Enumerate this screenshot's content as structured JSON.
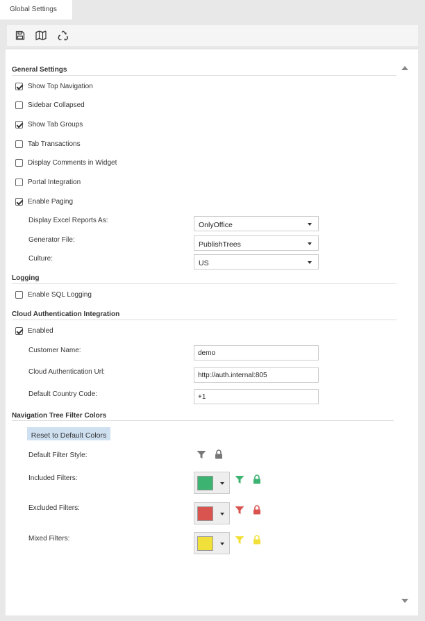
{
  "tab": {
    "title": "Global Settings"
  },
  "toolbar": {
    "save_icon": "save-icon",
    "map_icon": "map-icon",
    "recycle_icon": "recycle-icon"
  },
  "general": {
    "title": "General Settings",
    "checkboxes": [
      {
        "label": "Show Top Navigation",
        "checked": true
      },
      {
        "label": "Sidebar Collapsed",
        "checked": false
      },
      {
        "label": "Show Tab Groups",
        "checked": true
      },
      {
        "label": "Tab Transactions",
        "checked": false
      },
      {
        "label": "Display Comments in Widget",
        "checked": false
      },
      {
        "label": "Portal Integration",
        "checked": false
      },
      {
        "label": "Enable Paging",
        "checked": true
      }
    ],
    "excel_label": "Display Excel Reports As:",
    "excel_value": "OnlyOffice",
    "generator_label": "Generator File:",
    "generator_value": "PublishTrees",
    "culture_label": "Culture:",
    "culture_value": "US"
  },
  "logging": {
    "title": "Logging",
    "sql_label": "Enable SQL Logging",
    "sql_checked": false
  },
  "cloud": {
    "title": "Cloud Authentication Integration",
    "enabled_label": "Enabled",
    "enabled_checked": true,
    "customer_label": "Customer Name:",
    "customer_value": "demo",
    "url_label": "Cloud Authentication Url:",
    "url_value": "http://auth.internal:805",
    "country_label": "Default Country Code:",
    "country_value": "+1"
  },
  "filters": {
    "title": "Navigation Tree Filter Colors",
    "reset_label": "Reset to Default Colors",
    "default_label": "Default Filter Style:",
    "included_label": "Included Filters:",
    "excluded_label": "Excluded Filters:",
    "mixed_label": "Mixed Filters:",
    "colors": {
      "default": "#777777",
      "included": "#3cb371",
      "excluded": "#d9534f",
      "mixed": "#f2e03a"
    }
  }
}
